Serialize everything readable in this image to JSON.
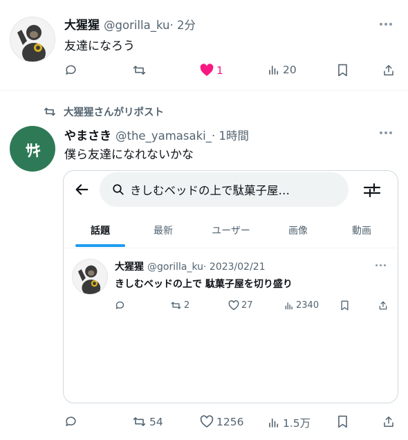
{
  "tweet1": {
    "avatar_icon": "gorilla-avatar",
    "name": "大猩猩",
    "handle": "@gorilla_ku",
    "time": "· 2分",
    "text": "友達になろう",
    "actions": {
      "reply": "",
      "retweet": "",
      "like": "1",
      "like_color": "#f91880",
      "views": "20"
    }
  },
  "repost_notice": {
    "icon": "retweet-icon",
    "text": "大猩猩さんがリポスト"
  },
  "tweet2": {
    "avatar_text": "ｻｷ",
    "avatar_color": "#2e7a56",
    "name": "やまさき",
    "handle": "@the_yamasaki_",
    "time": "· 1時間",
    "text": "僕ら友達になれないかな",
    "actions": {
      "reply": "",
      "retweet": "54",
      "like": "1256",
      "views": "1.5万"
    },
    "embedded": {
      "search_query": "きしむベッドの上で駄菓子屋…",
      "tabs": [
        "話題",
        "最新",
        "ユーザー",
        "画像",
        "動画"
      ],
      "active_tab": "話題",
      "accent_color": "#1d9bf0",
      "inner_tweet": {
        "name": "大猩猩",
        "handle": "@gorilla_ku",
        "time": "· 2023/02/21",
        "text": "きしむベッドの上で 駄菓子屋を切り盛り",
        "actions": {
          "retweet": "2",
          "like": "27",
          "views": "2340"
        }
      }
    }
  }
}
